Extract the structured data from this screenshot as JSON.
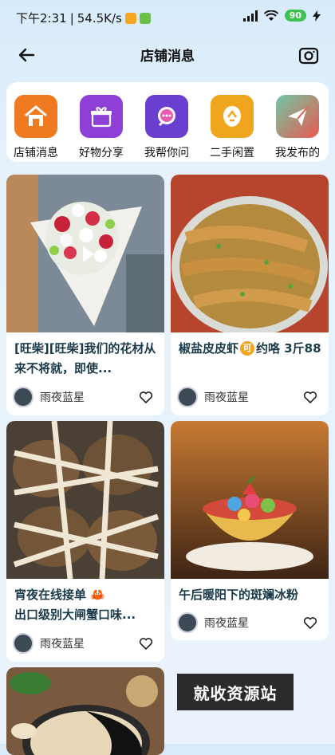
{
  "status_bar": {
    "time": "下午2:31",
    "speed": "54.5K/s",
    "battery": "90"
  },
  "header": {
    "title": "店铺消息"
  },
  "categories": [
    {
      "label": "店铺消息",
      "icon": "shop-news-icon",
      "color": "#f07a1f"
    },
    {
      "label": "好物分享",
      "icon": "gift-icon",
      "color": "#8e3fd6"
    },
    {
      "label": "我帮你问",
      "icon": "chat-bubble-icon",
      "color": "#6a3fcf"
    },
    {
      "label": "二手闲置",
      "icon": "recycle-icon",
      "color": "#f0a51f"
    },
    {
      "label": "我发布的",
      "icon": "paper-plane-icon",
      "color": "#ea5a4f"
    }
  ],
  "posts": [
    {
      "title": "[旺柴][旺柴]我们的花材从来不将就，即使...",
      "author": "雨夜蓝星",
      "image": "flower-bouquet-photo"
    },
    {
      "title": "椒盐皮皮虾",
      "title_badge": "可",
      "title_suffix": "约咯 3斤88",
      "author": "雨夜蓝星",
      "image": "mantis-shrimp-photo"
    },
    {
      "title": "宵夜在线接单",
      "title_emoji": "🦀",
      "title_line2": "出口级别大闸蟹口味...",
      "author": "雨夜蓝星",
      "image": "hairy-crab-photo"
    },
    {
      "title": "午后暖阳下的斑斓冰粉",
      "author": "雨夜蓝星",
      "image": "ice-jelly-dessert-photo"
    },
    {
      "image": "sesame-paste-photo"
    }
  ],
  "watermark": "就收资源站"
}
